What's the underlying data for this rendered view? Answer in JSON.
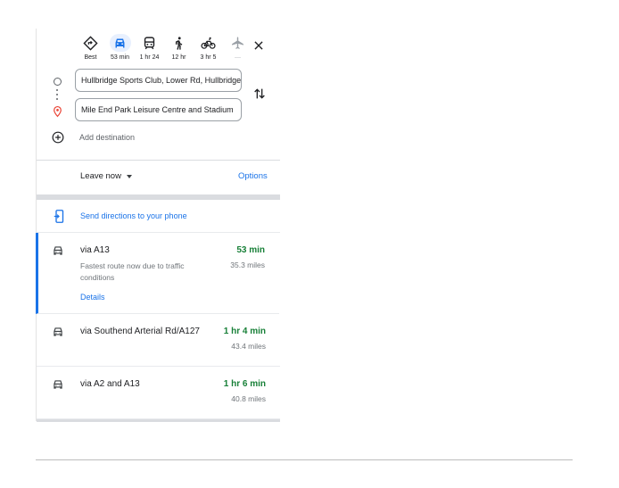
{
  "travel_modes": [
    {
      "name": "best",
      "label": "Best",
      "icon": "diamond-directions-icon",
      "selected": false
    },
    {
      "name": "driving",
      "label": "53 min",
      "icon": "car-icon",
      "selected": true
    },
    {
      "name": "transit",
      "label": "1 hr 24",
      "icon": "train-icon",
      "selected": false
    },
    {
      "name": "walking",
      "label": "12 hr",
      "icon": "walking-icon",
      "selected": false
    },
    {
      "name": "cycling",
      "label": "3 hr 5",
      "icon": "bicycle-icon",
      "selected": false
    },
    {
      "name": "flight",
      "label": "—",
      "icon": "airplane-icon",
      "selected": false
    }
  ],
  "waypoints": {
    "origin": "Hullbridge Sports Club, Lower Rd, Hullbridge",
    "destination": "Mile End Park Leisure Centre and Stadium"
  },
  "add_destination": "Add destination",
  "depart": {
    "leave_label": "Leave now",
    "options_label": "Options"
  },
  "send_to_phone": "Send directions to your phone",
  "routes": [
    {
      "via": "via A13",
      "duration": "53 min",
      "distance": "35.3 miles",
      "description": "Fastest route now due to traffic conditions",
      "details_label": "Details"
    },
    {
      "via": "via Southend Arterial Rd/A127",
      "duration": "1 hr 4 min",
      "distance": "43.4 miles"
    },
    {
      "via": "via A2 and A13",
      "duration": "1 hr 6 min",
      "distance": "40.8 miles"
    }
  ],
  "colors": {
    "accent": "#1a73e8",
    "duration_green": "#188038",
    "selected_mode_bg": "#e8f0fe",
    "pin_red": "#ea4335"
  }
}
